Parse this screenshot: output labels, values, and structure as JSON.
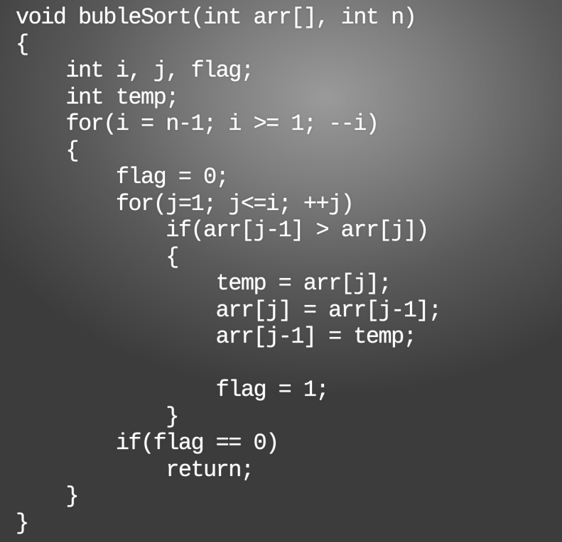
{
  "code": {
    "lines": [
      "void bubleSort(int arr[], int n)",
      "{",
      "    int i, j, flag;",
      "    int temp;",
      "    for(i = n-1; i >= 1; --i)",
      "    {",
      "        flag = 0;",
      "        for(j=1; j<=i; ++j)",
      "            if(arr[j-1] > arr[j])",
      "            {",
      "                temp = arr[j];",
      "                arr[j] = arr[j-1];",
      "                arr[j-1] = temp;",
      "",
      "                flag = 1;",
      "            }",
      "        if(flag == 0)",
      "            return;",
      "    }",
      "}"
    ]
  },
  "colors": {
    "text": "#ffffff",
    "background_light": "#9a9a9a",
    "background_dark": "#3c3c3c"
  }
}
